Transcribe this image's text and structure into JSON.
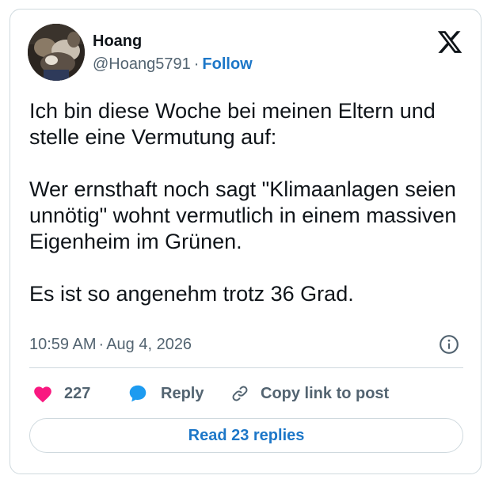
{
  "author": {
    "name": "Hoang",
    "handle": "@Hoang5791",
    "separator": "·",
    "follow_label": "Follow"
  },
  "tweet": {
    "paragraphs": [
      "Ich bin diese Woche bei meinen Eltern und stelle eine Vermutung auf:",
      "Wer ernsthaft noch sagt \"Klimaanlagen seien unnötig\" wohnt vermutlich in einem massiven Eigenheim im Grünen.",
      "Es ist so angenehm trotz 36 Grad."
    ],
    "time": "10:59 AM",
    "separator": "·",
    "date": "Aug 4, 2026"
  },
  "actions": {
    "like_count": "227",
    "reply_label": "Reply",
    "copy_label": "Copy link to post",
    "read_replies_label": "Read 23 replies"
  },
  "icons": {
    "logo": "x-logo-icon",
    "info": "info-icon",
    "like": "heart-icon",
    "reply": "reply-bubble-icon",
    "copy": "link-icon"
  },
  "colors": {
    "accent": "#1d77c8",
    "heart": "#f91880",
    "reply_bubble": "#1d9bf0",
    "muted_text": "#536471",
    "border": "#cfd9de"
  }
}
